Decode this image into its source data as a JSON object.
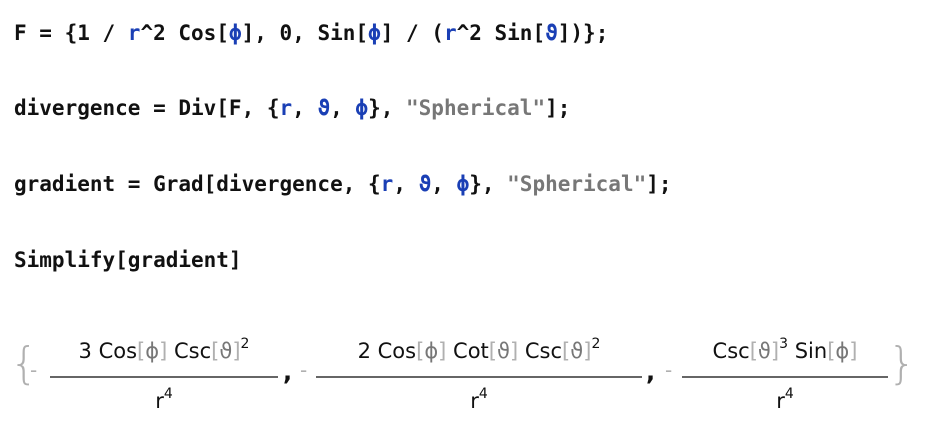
{
  "input": {
    "line1": {
      "a": "F = {1 / ",
      "r": "r",
      "b": "^2 Cos[",
      "phi": "ϕ",
      "c": "], 0, Sin[",
      "phi2": "ϕ",
      "d": "] / (",
      "r2": "r",
      "e": "^2 Sin[",
      "theta": "ϑ",
      "f": "])};"
    },
    "line2": {
      "a": "divergence = Div[F, {",
      "r": "r",
      "sep1": ", ",
      "theta": "ϑ",
      "sep2": ", ",
      "phi": "ϕ",
      "b": "}, ",
      "str": "\"Spherical\"",
      "c": "];"
    },
    "line3": {
      "a": "gradient = Grad[divergence, {",
      "r": "r",
      "sep1": ", ",
      "theta": "ϑ",
      "sep2": ", ",
      "phi": "ϕ",
      "b": "}, ",
      "str": "\"Spherical\"",
      "c": "];"
    },
    "line4": "Simplify[gradient]"
  },
  "output": {
    "open_brace": "{",
    "close_brace": "}",
    "minus": "-",
    "comma": ",",
    "terms": [
      {
        "num_coef": "3 Cos",
        "num_lb": "[",
        "num_var1": "ϕ",
        "num_rb": "]",
        "num_fn2": " Csc",
        "num_lb2": "[",
        "num_var2": "ϑ",
        "num_rb2": "]",
        "num_pow": "2",
        "den": "r",
        "den_pow": "4"
      },
      {
        "num_coef": "2 Cos",
        "num_lb": "[",
        "num_var1": "ϕ",
        "num_rb": "]",
        "num_mid": " Cot",
        "num_lb_mid": "[",
        "num_var_mid": "ϑ",
        "num_rb_mid": "]",
        "num_fn2": " Csc",
        "num_lb2": "[",
        "num_var2": "ϑ",
        "num_rb2": "]",
        "num_pow": "2",
        "den": "r",
        "den_pow": "4"
      },
      {
        "num_fn1": "Csc",
        "num_lb": "[",
        "num_var1": "ϑ",
        "num_rb": "]",
        "num_pow": "3",
        "num_fn2": " Sin",
        "num_lb2": "[",
        "num_var2": "ϕ",
        "num_rb2": "]",
        "den": "r",
        "den_pow": "4"
      }
    ]
  }
}
